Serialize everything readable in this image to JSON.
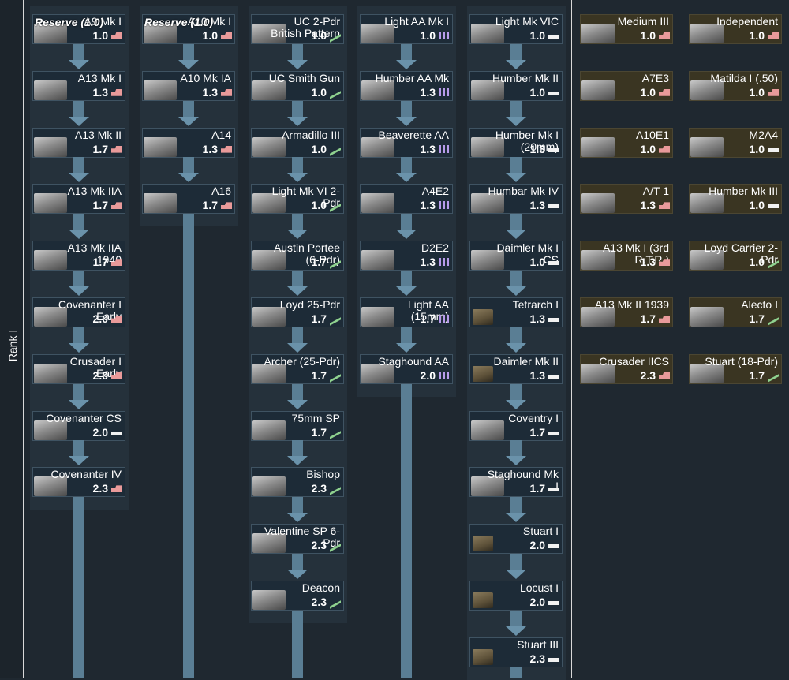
{
  "rank_label": "Rank I",
  "colors": {
    "background": "#1f2830",
    "card": "#1d2b37",
    "premium_card": "#3a3522",
    "connector": "#5a7e94"
  },
  "columns": [
    {
      "id": "col1",
      "cards": [
        {
          "name": "A9 Mk I",
          "br": "1.0",
          "role": "red",
          "reserve": "Reserve (1.0)"
        },
        {
          "name": "A13 Mk I",
          "br": "1.3",
          "role": "red"
        },
        {
          "name": "A13 Mk II",
          "br": "1.7",
          "role": "red"
        },
        {
          "name": "A13 Mk IIA",
          "br": "1.7",
          "role": "red"
        },
        {
          "name": "A13 Mk IIA\n1940",
          "br": "1.7",
          "role": "red"
        },
        {
          "name": "Covenanter I\nEarly",
          "br": "2.0",
          "role": "red"
        },
        {
          "name": "Crusader I\nEarly",
          "br": "2.0",
          "role": "red"
        },
        {
          "name": "Covenanter CS",
          "br": "2.0",
          "role": "white"
        },
        {
          "name": "Covenanter IV",
          "br": "2.3",
          "role": "red"
        }
      ]
    },
    {
      "id": "col2",
      "cards": [
        {
          "name": "A10 Mk I",
          "br": "1.0",
          "role": "red",
          "reserve": "Reserve (1.0)"
        },
        {
          "name": "A10 Mk IA",
          "br": "1.3",
          "role": "red"
        },
        {
          "name": "A14",
          "br": "1.3",
          "role": "red"
        },
        {
          "name": "A16",
          "br": "1.7",
          "role": "red"
        }
      ]
    },
    {
      "id": "col3",
      "cards": [
        {
          "name": "UC 2-Pdr\nBritish Pattern",
          "br": "1.0",
          "role": "green"
        },
        {
          "name": "UC Smith Gun",
          "br": "1.0",
          "role": "green"
        },
        {
          "name": "Armadillo III",
          "br": "1.0",
          "role": "green"
        },
        {
          "name": "Light Mk VI 2-\nPdr",
          "br": "1.0",
          "role": "green"
        },
        {
          "name": "Austin Portee\n(6-Pdr)",
          "br": "1.7",
          "role": "green"
        },
        {
          "name": "Loyd 25-Pdr",
          "br": "1.7",
          "role": "green"
        },
        {
          "name": "Archer (25-Pdr)",
          "br": "1.7",
          "role": "green"
        },
        {
          "name": "75mm SP",
          "br": "1.7",
          "role": "green"
        },
        {
          "name": "Bishop",
          "br": "2.3",
          "role": "green"
        },
        {
          "name": "Valentine SP 6-\nPdr",
          "br": "2.3",
          "role": "green"
        },
        {
          "name": "Deacon",
          "br": "2.3",
          "role": "green"
        }
      ]
    },
    {
      "id": "col4",
      "cards": [
        {
          "name": "Light AA Mk I",
          "br": "1.0",
          "role": "purple"
        },
        {
          "name": "Humber AA Mk",
          "br": "1.3",
          "role": "purple"
        },
        {
          "name": "Beaverette AA",
          "br": "1.3",
          "role": "purple"
        },
        {
          "name": "A4E2",
          "br": "1.3",
          "role": "purple"
        },
        {
          "name": "D2E2",
          "br": "1.3",
          "role": "purple"
        },
        {
          "name": "Light AA\n(15mm)",
          "br": "1.7",
          "role": "purple"
        },
        {
          "name": "Staghound AA",
          "br": "2.0",
          "role": "purple"
        }
      ]
    },
    {
      "id": "col5",
      "cards": [
        {
          "name": "Light Mk VIC",
          "br": "1.0",
          "role": "white"
        },
        {
          "name": "Humber Mk II",
          "br": "1.0",
          "role": "white"
        },
        {
          "name": "Humber Mk I\n(20mm)",
          "br": "1.3",
          "role": "white"
        },
        {
          "name": "Humbar Mk IV",
          "br": "1.3",
          "role": "white"
        },
        {
          "name": "Daimler Mk I\nCS",
          "br": "1.0",
          "role": "white"
        },
        {
          "name": "Tetrarch I",
          "br": "1.3",
          "role": "white"
        },
        {
          "name": "Daimler Mk II",
          "br": "1.3",
          "role": "white"
        },
        {
          "name": "Coventry I",
          "br": "1.7",
          "role": "white"
        },
        {
          "name": "Staghound Mk\nI",
          "br": "1.7",
          "role": "white"
        },
        {
          "name": "Stuart I",
          "br": "2.0",
          "role": "white"
        },
        {
          "name": "Locust I",
          "br": "2.0",
          "role": "white"
        },
        {
          "name": "Stuart III",
          "br": "2.3",
          "role": "white"
        }
      ]
    },
    {
      "id": "col6",
      "premium": true,
      "cards": [
        {
          "name": "Medium III",
          "br": "1.0",
          "role": "red"
        },
        {
          "name": "A7E3",
          "br": "1.0",
          "role": "red"
        },
        {
          "name": "A10E1",
          "br": "1.0",
          "role": "red"
        },
        {
          "name": "A/T 1",
          "br": "1.3",
          "role": "red"
        },
        {
          "name": "A13 Mk I (3rd\nR.T.R.)",
          "br": "1.3",
          "role": "red"
        },
        {
          "name": "A13 Mk II 1939",
          "br": "1.7",
          "role": "red"
        },
        {
          "name": "Crusader IICS",
          "br": "2.3",
          "role": "red"
        }
      ]
    },
    {
      "id": "col7",
      "premium": true,
      "cards": [
        {
          "name": "Independent",
          "br": "1.0",
          "role": "red"
        },
        {
          "name": "Matilda I (.50)",
          "br": "1.0",
          "role": "red"
        },
        {
          "name": "M2A4",
          "br": "1.0",
          "role": "white"
        },
        {
          "name": "Humber Mk III",
          "br": "1.0",
          "role": "white"
        },
        {
          "name": "Loyd Carrier 2-\nPdr",
          "br": "1.0",
          "role": "green"
        },
        {
          "name": "Alecto I",
          "br": "1.7",
          "role": "green"
        },
        {
          "name": "Stuart (18-Pdr)",
          "br": "1.7",
          "role": "green"
        }
      ]
    }
  ]
}
